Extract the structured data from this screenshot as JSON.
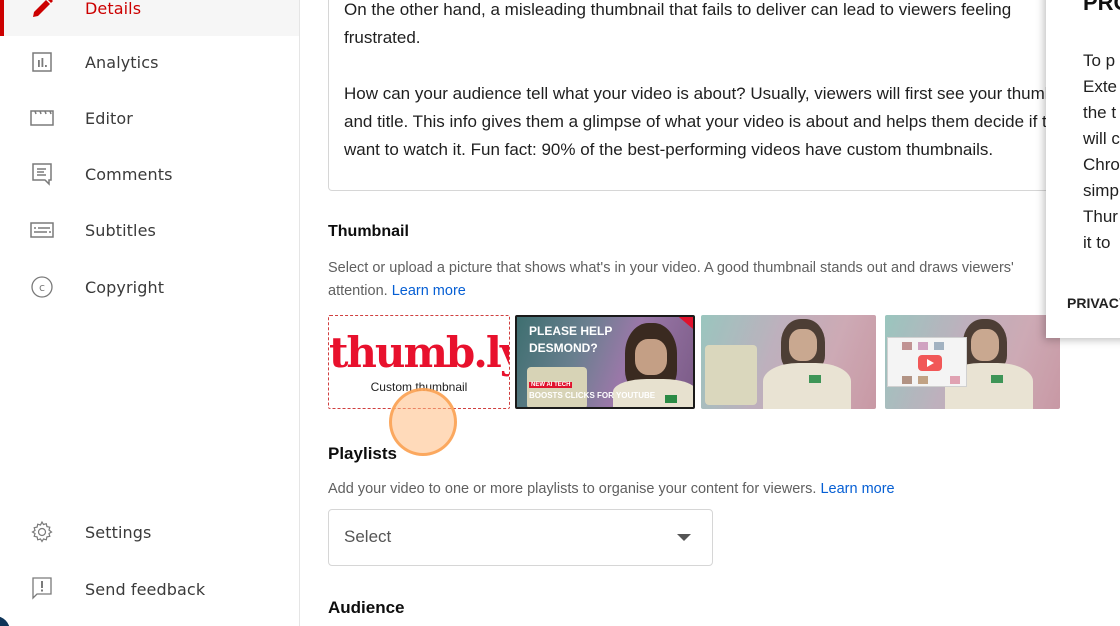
{
  "sidebar": {
    "items": [
      {
        "label": "Details",
        "icon": "pencil-icon",
        "active": true
      },
      {
        "label": "Analytics",
        "icon": "analytics-icon"
      },
      {
        "label": "Editor",
        "icon": "clapperboard-icon"
      },
      {
        "label": "Comments",
        "icon": "comment-icon"
      },
      {
        "label": "Subtitles",
        "icon": "subtitles-icon"
      },
      {
        "label": "Copyright",
        "icon": "copyright-icon"
      }
    ],
    "footer_items": [
      {
        "label": "Settings",
        "icon": "gear-icon"
      },
      {
        "label": "Send feedback",
        "icon": "feedback-icon"
      }
    ]
  },
  "description": {
    "text": "On the other hand, a misleading thumbnail that fails to deliver can lead to viewers feeling\nfrustrated.\n\nHow can your audience tell what your video is about? Usually, viewers will first see your thumbnail\nand title. This info gives them a glimpse of what your video is about and helps them decide if they\nwant to watch it. Fun fact: 90% of the best-performing videos have custom thumbnails."
  },
  "thumbnail": {
    "title": "Thumbnail",
    "desc_line1": "Select or upload a picture that shows what's in your video. A good thumbnail stands out and draws viewers'",
    "desc_line2": "attention. ",
    "learn_more": "Learn more",
    "custom": {
      "brand": "thumb.ly",
      "caption": "Custom thumbnail"
    },
    "options": [
      {
        "headline_1": "PLEASE HELP",
        "headline_2": "DESMOND?",
        "tag": "NEW AI TECH",
        "subline": "BOOSTS CLICKS FOR YOUTUBE",
        "selected": true
      },
      {
        "selected": false
      },
      {
        "selected": false
      }
    ]
  },
  "playlists": {
    "title": "Playlists",
    "desc": "Add your video to one or more playlists to organise your content for viewers. ",
    "learn_more": "Learn more",
    "select_value": "Select"
  },
  "audience": {
    "title": "Audience"
  },
  "popup": {
    "title": "PRO",
    "body_lines": [
      "To p",
      "Exte",
      "the t",
      "will c",
      "Chro",
      "simp",
      "Thur",
      "it to"
    ],
    "footer": "PRIVACY"
  },
  "colors": {
    "accent": "#cc0000",
    "link": "#065fd4",
    "brand_red": "#e8112d"
  }
}
